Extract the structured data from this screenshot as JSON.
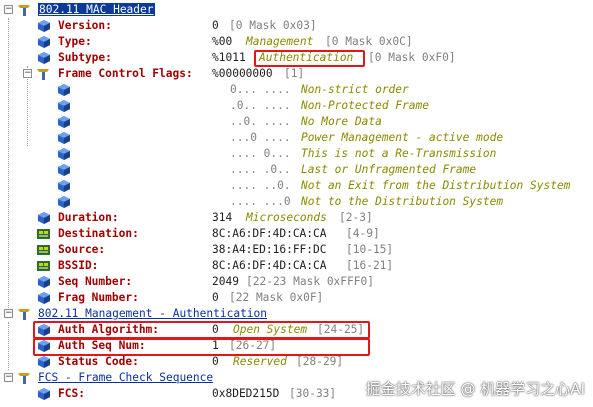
{
  "mac_header": {
    "title": "802.11 MAC Header",
    "fields": {
      "version": {
        "label": "Version:",
        "value": "0",
        "mask": "[0 Mask 0x03]"
      },
      "type": {
        "label": "Type:",
        "value": "%00",
        "desc": "Management",
        "mask": "[0 Mask 0x0C]"
      },
      "subtype": {
        "label": "Subtype:",
        "value": "%1011",
        "desc": "Authentication",
        "mask": "[0 Mask 0xF0]"
      },
      "fcf": {
        "label": "Frame Control Flags:",
        "value": "%00000000",
        "mask": "[1]"
      },
      "flags": [
        {
          "bits": "0... ....",
          "desc": "Non-strict order"
        },
        {
          "bits": ".0.. ....",
          "desc": "Non-Protected Frame"
        },
        {
          "bits": "..0. ....",
          "desc": "No More Data"
        },
        {
          "bits": "...0 ....",
          "desc": "Power Management - active mode"
        },
        {
          "bits": ".... 0...",
          "desc": "This is not a Re-Transmission"
        },
        {
          "bits": ".... .0..",
          "desc": "Last or Unfragmented Frame"
        },
        {
          "bits": ".... ..0.",
          "desc": "Not an Exit from the Distribution System"
        },
        {
          "bits": ".... ...0",
          "desc": "Not to the Distribution System"
        }
      ],
      "duration": {
        "label": "Duration:",
        "value": "314",
        "desc": "Microseconds",
        "mask": "[2-3]"
      },
      "destination": {
        "label": "Destination:",
        "value": "8C:A6:DF:4D:CA:CA",
        "mask": "[4-9]"
      },
      "source": {
        "label": "Source:",
        "value": "38:A4:ED:16:FF:DC",
        "mask": "[10-15]"
      },
      "bssid": {
        "label": "BSSID:",
        "value": "8C:A6:DF:4D:CA:CA",
        "mask": "[16-21]"
      },
      "seq": {
        "label": "Seq Number:",
        "value": "2049",
        "mask": "[22-23 Mask 0xFFF0]"
      },
      "frag": {
        "label": "Frag Number:",
        "value": "0",
        "mask": "[22 Mask 0x0F]"
      }
    }
  },
  "mgmt_auth": {
    "title": "802.11 Management - Authentication",
    "fields": {
      "algo": {
        "label": "Auth Algorithm:",
        "value": "0",
        "desc": "Open System",
        "mask": "[24-25]"
      },
      "seqnum": {
        "label": "Auth Seq Num:",
        "value": "1",
        "mask": "[26-27]"
      },
      "status": {
        "label": "Status Code:",
        "value": "0",
        "desc": "Reserved",
        "mask": "[28-29]"
      }
    }
  },
  "fcs": {
    "title": "FCS - Frame Check Sequence",
    "fields": {
      "fcs": {
        "label": "FCS:",
        "value": "0x8DED215D",
        "mask": "[30-33]"
      }
    }
  },
  "watermark": "掘金技术社区 @ 机器学习之心AI",
  "colors": {
    "label": "#a00000",
    "desc": "#8a8a00",
    "mask": "#808080",
    "section": "#0b2fa0",
    "highlight": "#e01818"
  }
}
